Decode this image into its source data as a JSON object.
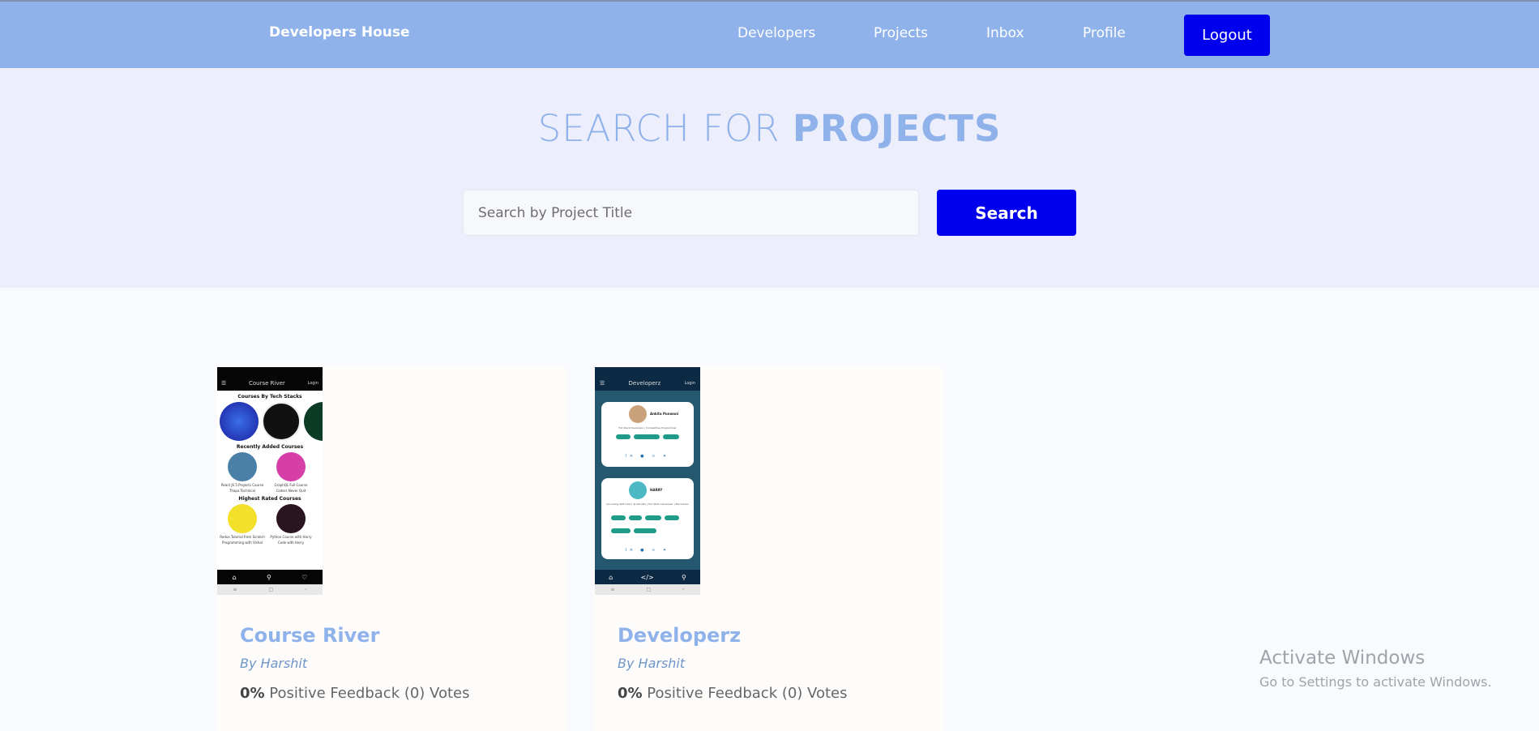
{
  "navbar": {
    "brand": "Developers House",
    "links": [
      "Developers",
      "Projects",
      "Inbox",
      "Profile"
    ],
    "logout_label": "Logout"
  },
  "hero": {
    "title_light": "SEARCH FOR ",
    "title_bold": "PROJECTS",
    "search_placeholder": "Search by Project Title",
    "search_button": "Search"
  },
  "projects": [
    {
      "title": "Course River",
      "author": "By Harshit",
      "feedback_percent": "0%",
      "feedback_text": " Positive Feedback (0) Votes",
      "screenshot": {
        "app_title": "Course River",
        "login": "Login",
        "section_1": "Courses By Tech Stacks",
        "section_2": "Recently Added Courses",
        "section_3": "Highest Rated Courses",
        "course_1": "React JS 5 Projects Course",
        "course_1_by": "Thapa Technical",
        "course_2": "GraphQL Full Course",
        "course_2_by": "Coders Never Quit",
        "course_3": "Redux Tutorial from Scratch",
        "course_3_by": "Programming with Vishal",
        "course_4": "Python Course with Harry",
        "course_4_by": "Code with Harry"
      }
    },
    {
      "title": "Developerz",
      "author": "By Harshit",
      "feedback_percent": "0%",
      "feedback_text": " Positive Feedback (0) Votes",
      "screenshot": {
        "app_title": "Developerz",
        "login": "Login",
        "dev_1_name": "Ankita Punwani",
        "dev_1_bio": "Full Stack Developer | Competitive Programmer",
        "dev_2_name": "HARRY",
        "dev_2_bio": "Upcoming SDE Intern @ Deloitte | Full Stack Developer | Blockchain"
      }
    }
  ],
  "watermark": {
    "title": "Activate Windows",
    "subtitle": "Go to Settings to activate Windows."
  },
  "colors": {
    "navbar": "#8fb2eb",
    "hero_bg": "#edeefc",
    "accent_button": "#0000ee",
    "title_blue": "#8fb2eb"
  }
}
